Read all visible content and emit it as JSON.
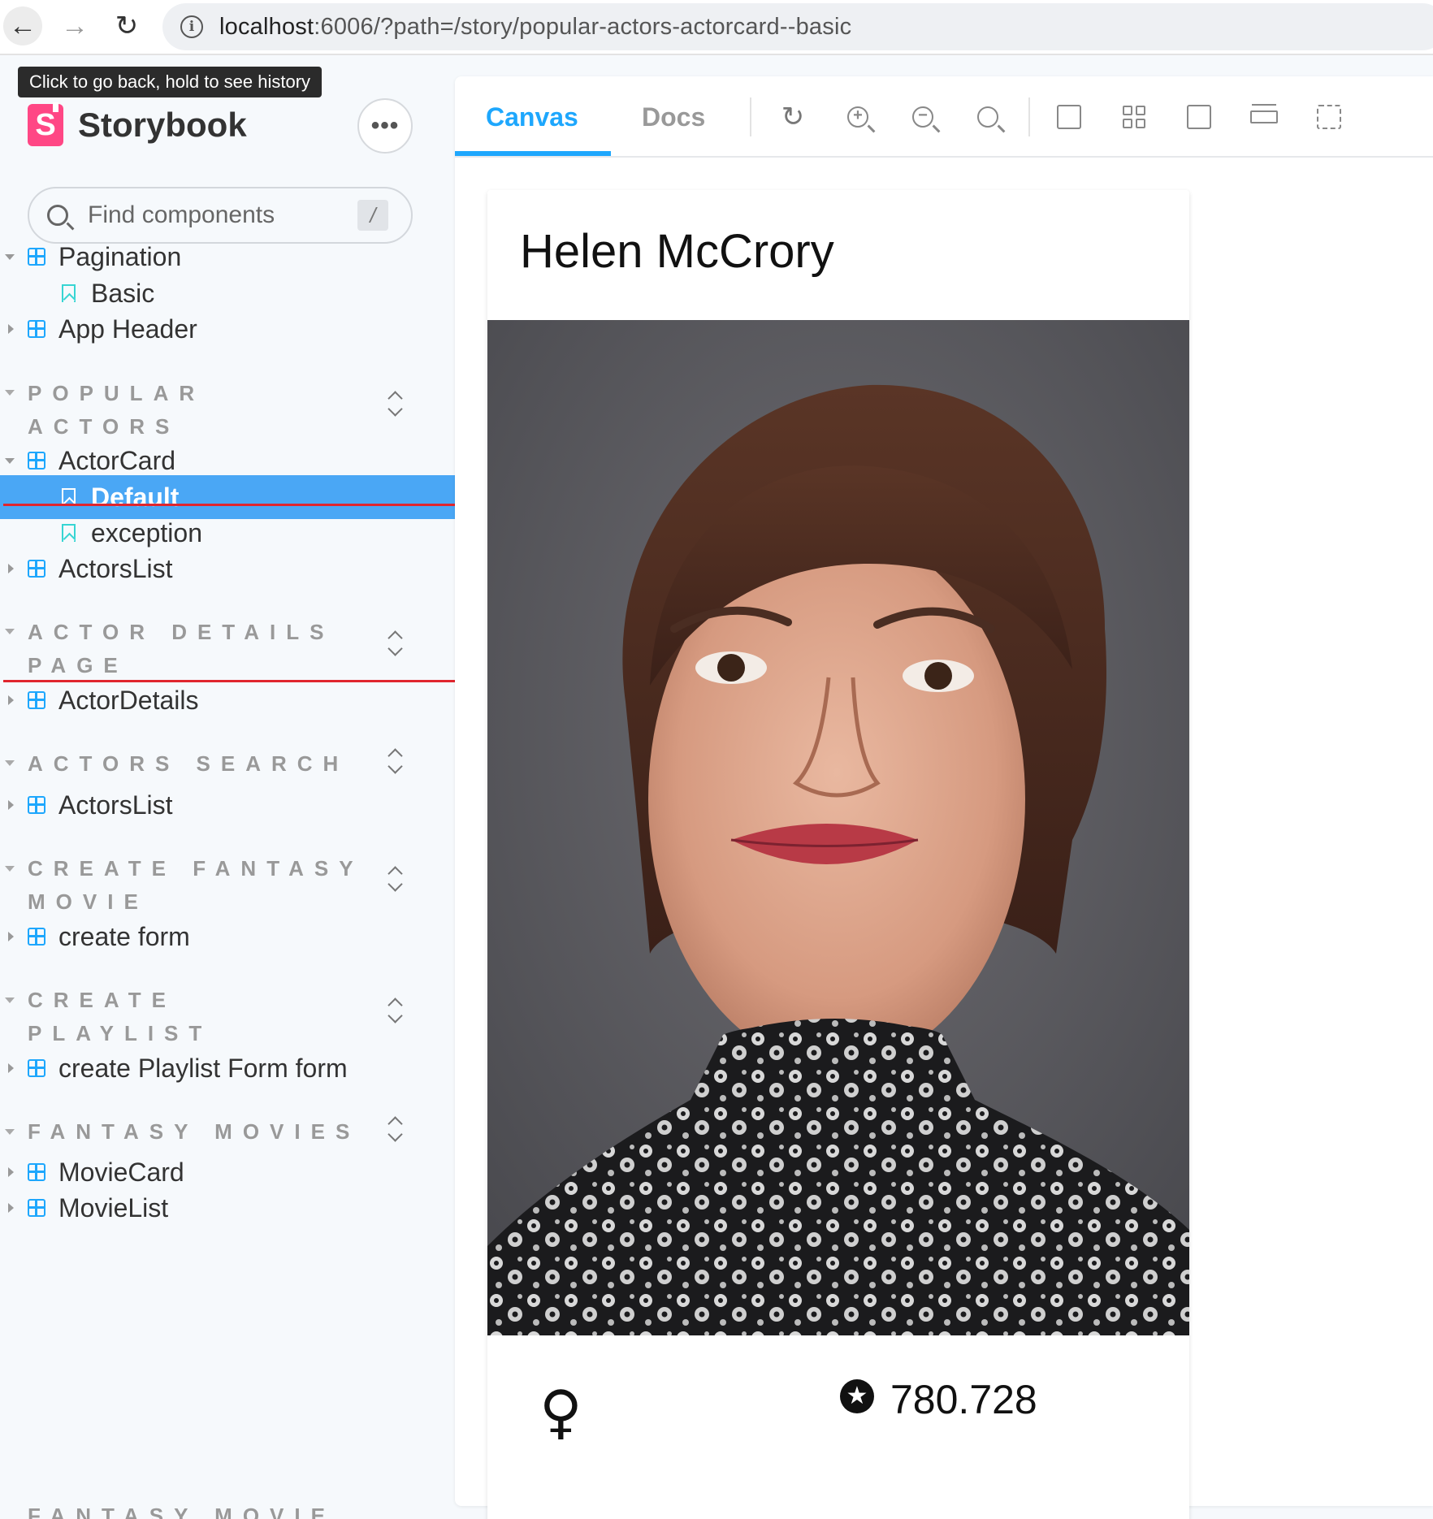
{
  "browser": {
    "url_host": "localhost",
    "url_rest": ":6006/?path=/story/popular-actors-actorcard--basic",
    "tooltip": "Click to go back, hold to see history"
  },
  "sidebar": {
    "brand": "Storybook",
    "more_label": "•••",
    "search_placeholder": "Find components",
    "search_shortcut": "/",
    "pagination": {
      "label": "Pagination",
      "story": "Basic"
    },
    "app_header": "App Header",
    "groups": {
      "popular_actors": {
        "line1": "POPULAR",
        "line2": "ACTORS"
      },
      "actor_details": {
        "line1": "ACTOR DETAILS",
        "line2": "PAGE"
      },
      "actors_search": {
        "line1": "ACTORS SEARCH"
      },
      "create_fantasy": {
        "line1": "CREATE FANTASY",
        "line2": "MOVIE"
      },
      "create_playlist": {
        "line1": "CREATE",
        "line2": "PLAYLIST"
      },
      "fantasy_movies": {
        "line1": "FANTASY MOVIES"
      },
      "fantasy_movie_partial": {
        "line1": "FANTASY MOVIE"
      }
    },
    "items": {
      "actorcard": "ActorCard",
      "default": "Default",
      "exception": "exception",
      "actorslist1": "ActorsList",
      "actordetails": "ActorDetails",
      "actorslist2": "ActorsList",
      "create_form": "create form",
      "playlist_form": "create Playlist Form form",
      "moviecard": "MovieCard",
      "movielist": "MovieList"
    }
  },
  "toolbar": {
    "tab_canvas": "Canvas",
    "tab_docs": "Docs"
  },
  "card": {
    "name": "Helen McCrory",
    "gender_symbol": "♀",
    "star_symbol": "★",
    "popularity": "780.728"
  },
  "colors": {
    "accent": "#1ea7fd",
    "selected_row": "#4aa7f5",
    "brand_pink": "#ff4785",
    "annotation_red": "#e0262e"
  }
}
